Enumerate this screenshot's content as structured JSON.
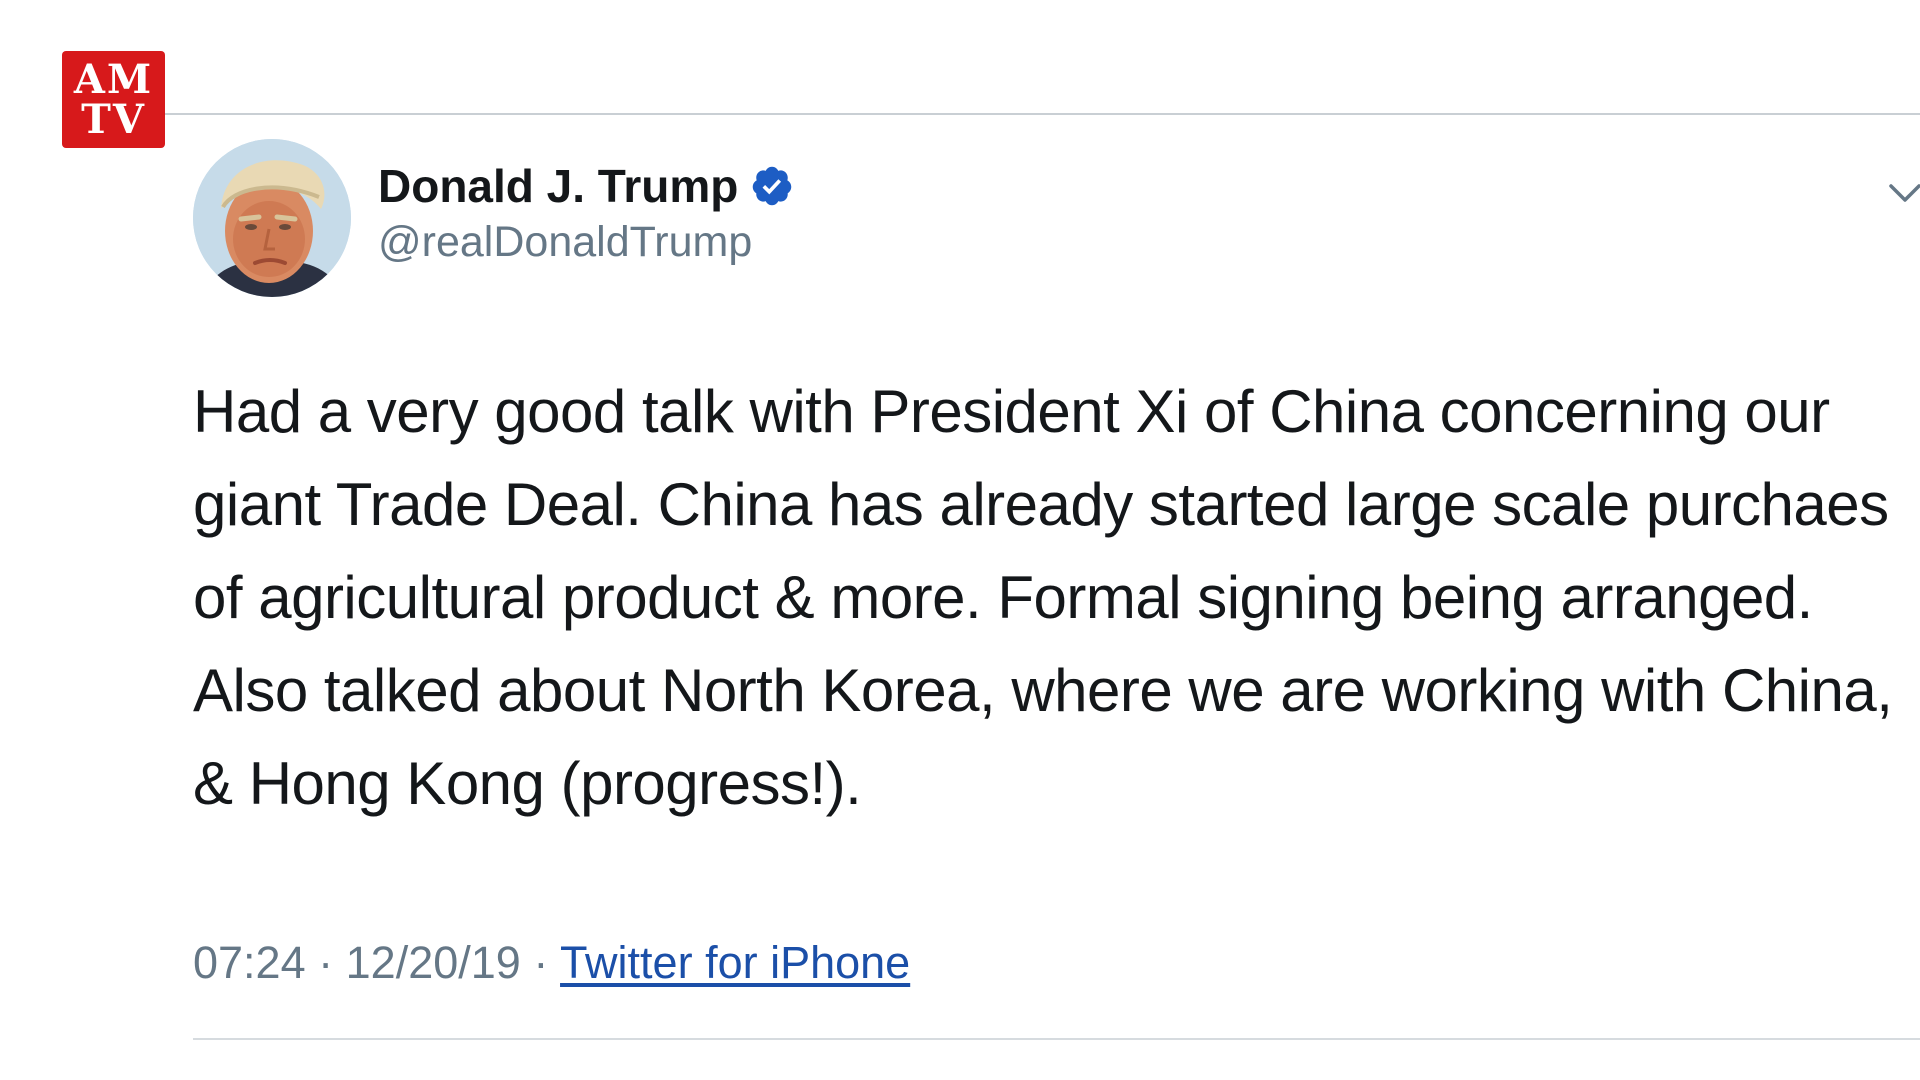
{
  "logo": {
    "line1": "AM",
    "line2": "TV",
    "color": "#d7191b"
  },
  "tweet": {
    "author_name": "Donald J. Trump",
    "author_handle": "@realDonaldTrump",
    "verified": true,
    "text": "Had a very good talk with President Xi of China concerning our giant Trade Deal. China has already started large scale purchaes of agricultural product & more. Formal signing being arranged. Also talked about North Korea, where we are working with China, & Hong Kong (progress!).",
    "time": "07:24",
    "date": "12/20/19",
    "separator": "·",
    "source": "Twitter for iPhone"
  },
  "icons": {
    "verified": "verified-badge-icon",
    "menu": "chevron-down-icon"
  },
  "colors": {
    "text": "#14171a",
    "secondary": "#657786",
    "link": "#1b4fa8",
    "verified": "#1d5dc4"
  }
}
